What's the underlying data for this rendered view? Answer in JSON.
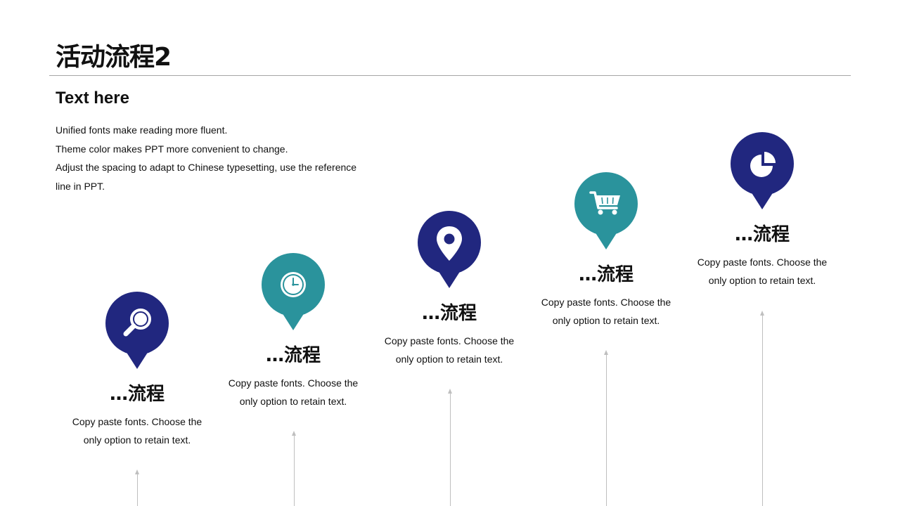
{
  "title": "活动流程2",
  "subtitle": "Text here",
  "intro_lines": [
    "Unified fonts make reading more fluent.",
    "Theme color makes PPT more convenient to change.",
    "Adjust the spacing to adapt to Chinese typesetting, use the reference line in PPT."
  ],
  "colors": {
    "navy": "#21277f",
    "teal": "#2a939c",
    "rule": "#a6a6a6",
    "arrow": "#bfbfbf"
  },
  "steps": [
    {
      "title": "…流程",
      "desc_line1": "Copy paste fonts. Choose the",
      "desc_line2": "only option to retain text.",
      "icon": "magnifier-icon",
      "color": "#21277f"
    },
    {
      "title": "…流程",
      "desc_line1": "Copy paste fonts. Choose the",
      "desc_line2": "only option to retain text.",
      "icon": "clock-icon",
      "color": "#2a939c"
    },
    {
      "title": "…流程",
      "desc_line1": "Copy paste fonts. Choose the",
      "desc_line2": "only option to retain text.",
      "icon": "location-pin-icon",
      "color": "#21277f"
    },
    {
      "title": "…流程",
      "desc_line1": "Copy paste fonts. Choose the",
      "desc_line2": "only option to retain text.",
      "icon": "shopping-cart-icon",
      "color": "#2a939c"
    },
    {
      "title": "…流程",
      "desc_line1": "Copy paste fonts. Choose the",
      "desc_line2": "only option to retain text.",
      "icon": "pie-chart-icon",
      "color": "#21277f"
    }
  ]
}
